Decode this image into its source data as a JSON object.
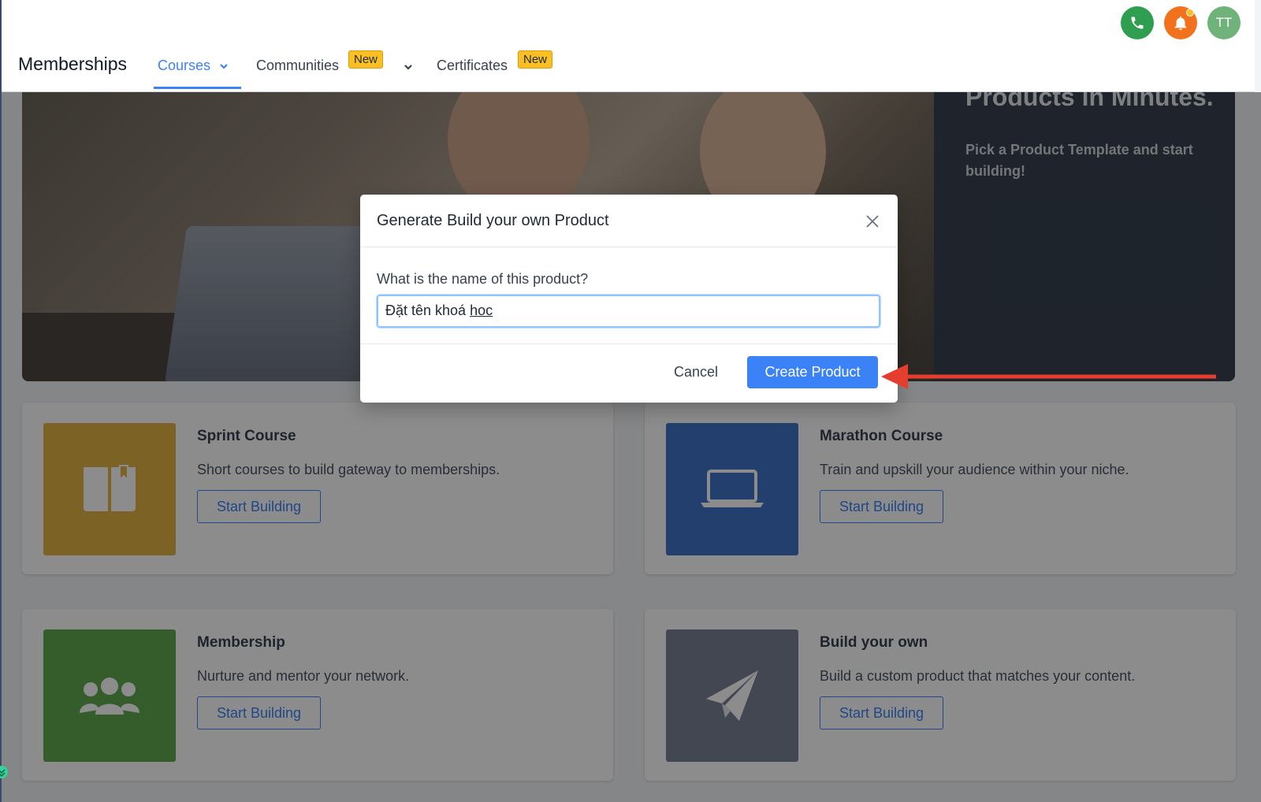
{
  "header": {
    "brand": "Memberships",
    "tabs": [
      {
        "label": "Courses",
        "active": true
      },
      {
        "label": "Communities",
        "badge": "New"
      },
      {
        "label": "Certificates",
        "badge": "New"
      }
    ],
    "avatar_initials": "TT",
    "icons": [
      "phone-icon",
      "bell-icon"
    ]
  },
  "hero": {
    "title": "Products in Minutes.",
    "subtitle": "Pick a Product Template and start building!"
  },
  "cards": [
    {
      "title": "Sprint Course",
      "description": "Short courses to build gateway to memberships.",
      "button": "Start Building",
      "color": "#e2b544",
      "icon": "book-icon"
    },
    {
      "title": "Marathon Course",
      "description": "Train and upskill your audience within your niche.",
      "button": "Start Building",
      "color": "#3f73c6",
      "icon": "laptop-icon"
    },
    {
      "title": "Membership",
      "description": "Nurture and mentor your network.",
      "button": "Start Building",
      "color": "#5fa94f",
      "icon": "users-icon"
    },
    {
      "title": "Build your own",
      "description": "Build a custom product that matches your content.",
      "button": "Start Building",
      "color": "#7b8294",
      "icon": "paper-plane-icon"
    }
  ],
  "modal": {
    "title": "Generate Build your own Product",
    "field_label": "What is the name of this product?",
    "input_value_plain": "Đặt tên khoá ",
    "input_value_underlined": "hoc",
    "cancel_label": "Cancel",
    "create_label": "Create Product"
  },
  "colors": {
    "accent": "#3b82f6",
    "phone": "#2f9e50",
    "bell": "#f2711c",
    "avatar": "#6fb37a",
    "arrow": "#e53e2f"
  }
}
